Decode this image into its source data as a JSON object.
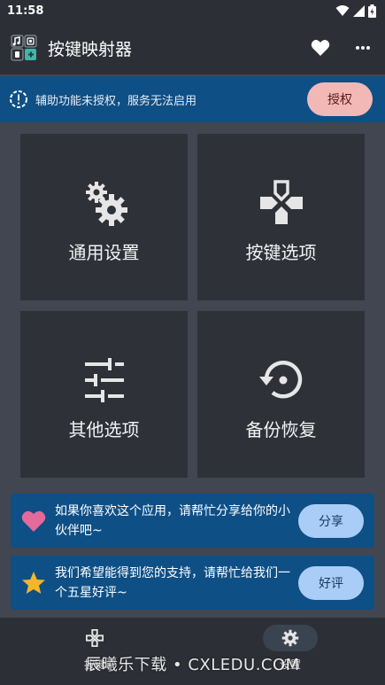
{
  "status_bar": {
    "time": "11:58",
    "icons": [
      "wifi-icon",
      "signal-icon",
      "battery-icon"
    ]
  },
  "app_bar": {
    "title": "按键映射器",
    "actions": [
      "heart-icon",
      "more-vert-icon"
    ]
  },
  "auth_banner": {
    "message": "辅助功能未授权，服务无法启用",
    "button_label": "授权",
    "icon": "warning-circle-icon"
  },
  "tiles": [
    {
      "label": "通用设置",
      "icon": "gears-icon"
    },
    {
      "label": "按键选项",
      "icon": "dpad-icon"
    },
    {
      "label": "其他选项",
      "icon": "sliders-icon"
    },
    {
      "label": "备份恢复",
      "icon": "restore-icon"
    }
  ],
  "cards": [
    {
      "text": "如果你喜欢这个应用，请帮忙分享给你的小伙伴吧~",
      "button_label": "分享",
      "icon": "heart-icon",
      "icon_color": "#e36a9a"
    },
    {
      "text": "我们希望能得到您的支持，请帮忙给我们一个五星好评~",
      "button_label": "好评",
      "icon": "star-icon",
      "icon_color": "#f5b52a"
    }
  ],
  "bottom_nav": [
    {
      "label": "按键",
      "icon": "dpad-icon",
      "active": false
    },
    {
      "label": "设置",
      "icon": "gear-icon",
      "active": true
    }
  ],
  "watermark": "辰曦乐下载 • CXLEDU.COM",
  "colors": {
    "background": "#424650",
    "bar": "#2c2f35",
    "banner": "#0e4f86",
    "tile": "#2e3138",
    "auth_button": "#f2b8b5",
    "card_button": "#aacdf7"
  }
}
